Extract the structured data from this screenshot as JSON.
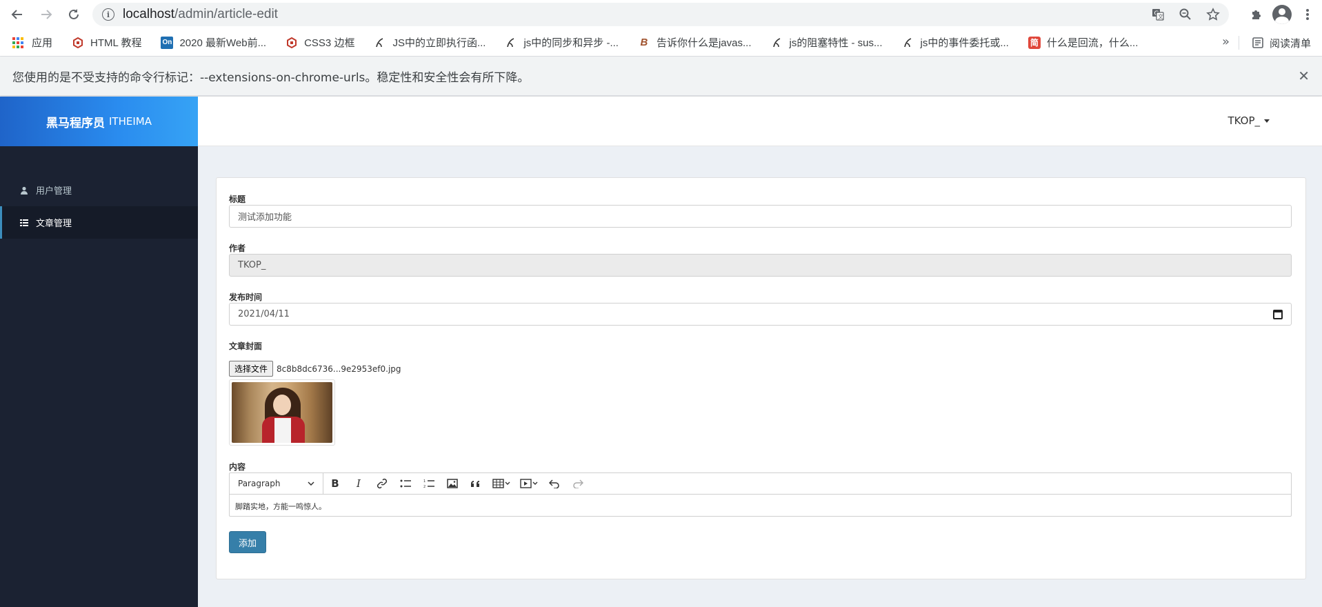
{
  "browser": {
    "url_host": "localhost",
    "url_path": "/admin/article-edit",
    "bookmarks": [
      {
        "label": "应用",
        "icon": "apps-grid-icon",
        "color": "#4285f4"
      },
      {
        "label": "HTML 教程",
        "icon": "runoob-icon",
        "color": "#c0392b"
      },
      {
        "label": "2020 最新Web前...",
        "icon": "on-icon",
        "color": "#1f6fb2"
      },
      {
        "label": "CSS3 边框",
        "icon": "runoob-icon",
        "color": "#c0392b"
      },
      {
        "label": "JS中的立即执行函...",
        "icon": "pen-icon",
        "color": "#333333"
      },
      {
        "label": "js中的同步和异步 -...",
        "icon": "pen-icon",
        "color": "#333333"
      },
      {
        "label": "告诉你什么是javas...",
        "icon": "b-icon",
        "color": "#a0522d"
      },
      {
        "label": "js的阻塞特性 - sus...",
        "icon": "pen-icon",
        "color": "#333333"
      },
      {
        "label": "js中的事件委托或...",
        "icon": "pen-icon",
        "color": "#333333"
      },
      {
        "label": "什么是回流，什么...",
        "icon": "jian-icon",
        "color": "#e0473b"
      }
    ],
    "more_label": "»",
    "reading_list": "阅读清单",
    "infobar_text": "您使用的是不受支持的命令行标记：--extensions-on-chrome-urls。稳定性和安全性会有所下降。"
  },
  "app": {
    "brand": "黑马程序员",
    "brand_sub": "ITHEIMA",
    "user": "TKOP_",
    "menu": [
      {
        "label": "用户管理",
        "icon": "user-icon"
      },
      {
        "label": "文章管理",
        "icon": "list-icon"
      }
    ]
  },
  "form": {
    "title_label": "标题",
    "title_value": "测试添加功能",
    "author_label": "作者",
    "author_value": "TKOP_",
    "date_label": "发布时间",
    "date_value": "2021/04/11",
    "cover_label": "文章封面",
    "file_button": "选择文件",
    "file_name": "8c8b8dc6736...9e2953ef0.jpg",
    "content_label": "内容",
    "paragraph_select": "Paragraph",
    "content_text": "脚踏实地，方能一鸣惊人。",
    "submit_label": "添加"
  },
  "colors": {
    "sidebar": "#1b2232",
    "accent": "#3c8dbc",
    "logo_gradient_start": "#1f64c9",
    "logo_gradient_end": "#36a3f5"
  }
}
